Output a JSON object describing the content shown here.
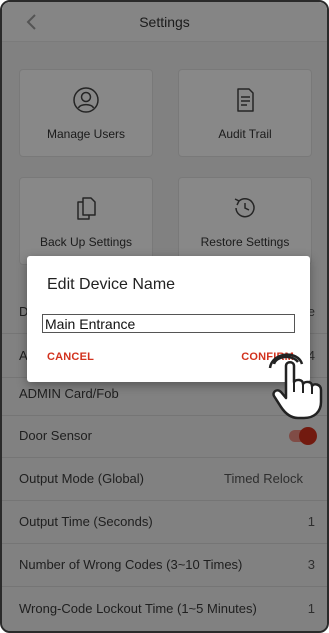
{
  "header": {
    "title": "Settings",
    "back_icon": "chevron-left-icon"
  },
  "tiles": [
    {
      "label": "Manage Users",
      "icon": "user-icon"
    },
    {
      "label": "Audit Trail",
      "icon": "document-icon"
    },
    {
      "label": "Back Up Settings",
      "icon": "copy-icon"
    },
    {
      "label": "Restore Settings",
      "icon": "history-icon"
    }
  ],
  "rows": [
    {
      "label": "D",
      "value": "e"
    },
    {
      "label": "A",
      "value": "4"
    },
    {
      "label": "ADMIN Card/Fob",
      "value": ""
    },
    {
      "label": "Door Sensor",
      "value": ""
    },
    {
      "label": "Output Mode (Global)",
      "value": "Timed Relock"
    },
    {
      "label": "Output Time (Seconds)",
      "value": "1"
    },
    {
      "label": "Number of Wrong Codes (3~10 Times)",
      "value": "3"
    },
    {
      "label": "Wrong-Code Lockout Time (1~5 Minutes)",
      "value": "1"
    }
  ],
  "door_sensor_toggle": {
    "state": "on",
    "color": "#d0301c"
  },
  "dialog": {
    "title": "Edit Device Name",
    "input_value": "Main Entrance",
    "cancel_label": "CANCEL",
    "confirm_label": "CONFIRM"
  },
  "colors": {
    "accent": "#d2321e"
  },
  "cursor_icon": "tap-hand-icon"
}
